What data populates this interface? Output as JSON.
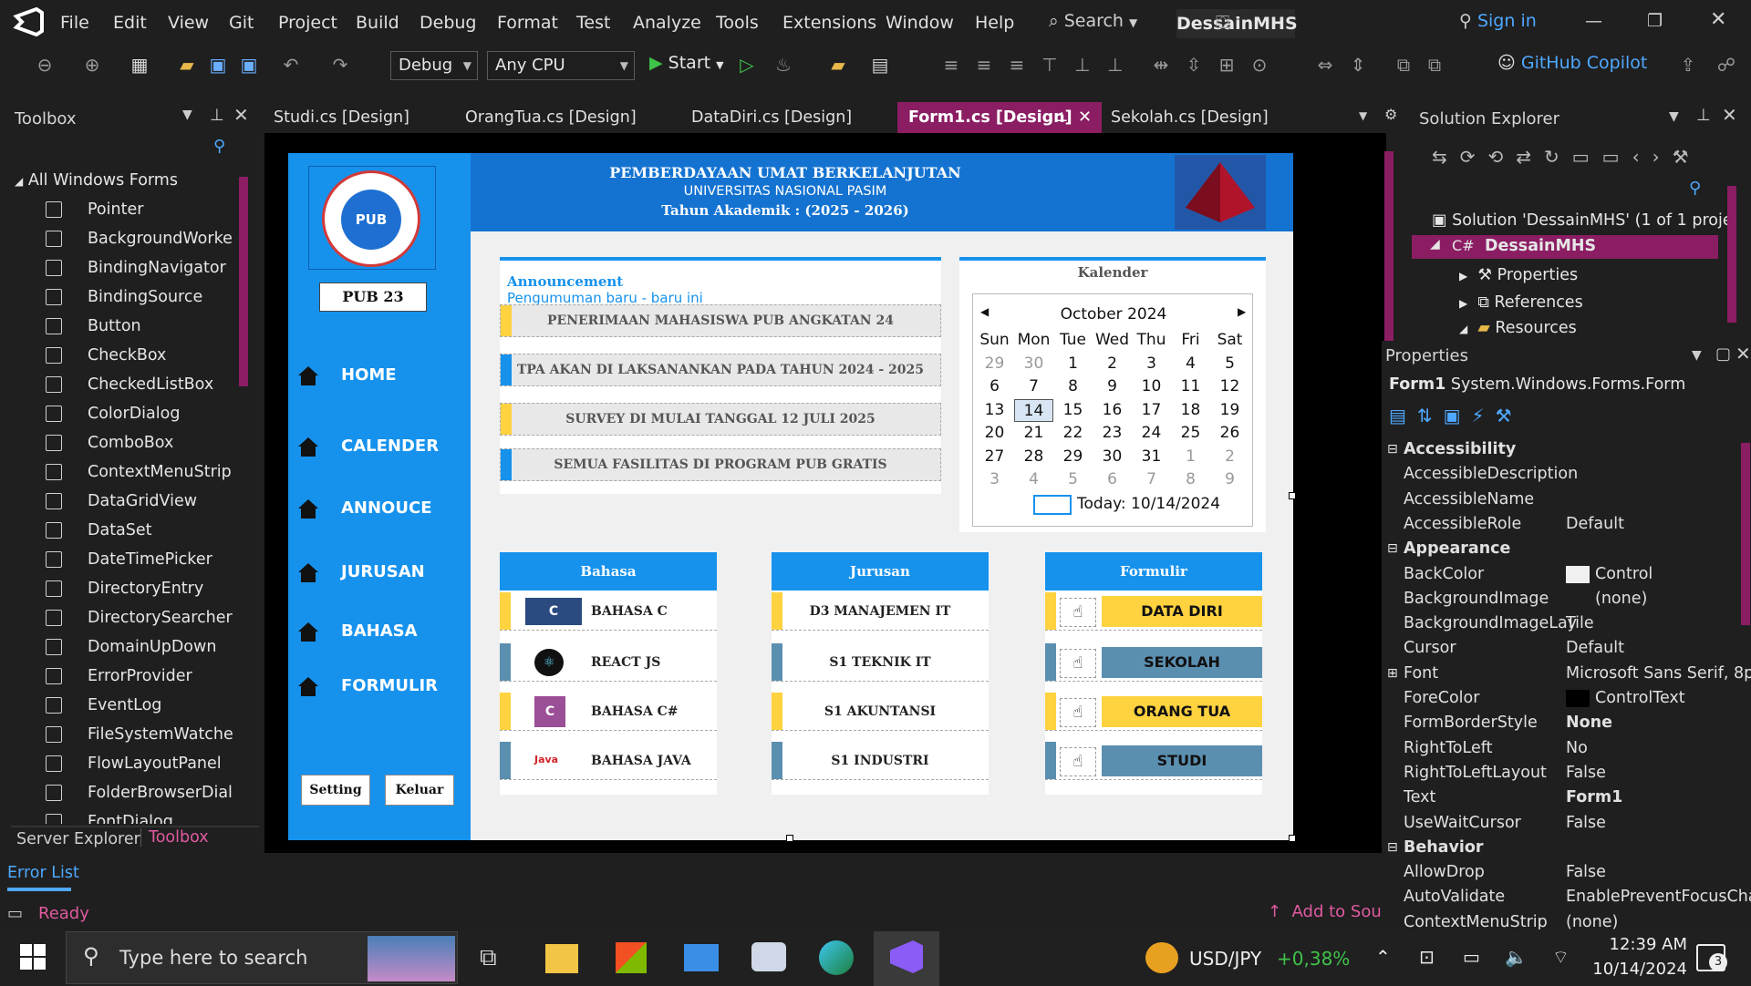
{
  "menu": {
    "items": [
      "File",
      "Edit",
      "View",
      "Git",
      "Project",
      "Build",
      "Debug",
      "Format",
      "Test",
      "Analyze",
      "Tools",
      "Extensions",
      "Window",
      "Help"
    ],
    "search": "Search",
    "solution_title": "DessainMHS",
    "signin": "Sign in"
  },
  "toolbar": {
    "config": "Debug",
    "platform": "Any CPU",
    "start": "Start",
    "copilot": "GitHub Copilot"
  },
  "toolbox": {
    "title": "Toolbox",
    "group": "All Windows Forms",
    "items": [
      "Pointer",
      "BackgroundWorker",
      "BindingNavigator",
      "BindingSource",
      "Button",
      "CheckBox",
      "CheckedListBox",
      "ColorDialog",
      "ComboBox",
      "ContextMenuStrip",
      "DataGridView",
      "DataSet",
      "DateTimePicker",
      "DirectoryEntry",
      "DirectorySearcher",
      "DomainUpDown",
      "ErrorProvider",
      "EventLog",
      "FileSystemWatcher",
      "FlowLayoutPanel",
      "FolderBrowserDial...",
      "FontDialog"
    ],
    "tab_server": "Server Explorer",
    "tab_toolbox": "Toolbox"
  },
  "tabs": [
    "Studi.cs [Design]",
    "OrangTua.cs [Design]",
    "DataDiri.cs [Design]",
    "Form1.cs [Design]",
    "Sekolah.cs [Design]"
  ],
  "form": {
    "logo_text": "PUB",
    "badge": "PUB 23",
    "nav": [
      "HOME",
      "CALENDER",
      "ANNOUCE",
      "JURUSAN",
      "BAHASA",
      "FORMULIR"
    ],
    "btn_setting": "Setting",
    "btn_keluar": "Keluar",
    "header": {
      "line1": "PEMBERDAYAAN UMAT BERKELANJUTAN",
      "line2": "UNIVERSITAS NASIONAL PASIM",
      "line3": "Tahun Akademik : (2025 - 2026)"
    },
    "announcement": {
      "title": "Announcement",
      "subtitle": "Pengumuman baru - baru ini",
      "rows": [
        "PENERIMAAN MAHASISWA PUB ANGKATAN 24",
        "TPA AKAN DI LAKSANANKAN PADA TAHUN 2024 - 2025",
        "SURVEY DI MULAI TANGGAL 12 JULI 2025",
        "SEMUA FASILITAS DI PROGRAM PUB GRATIS"
      ]
    },
    "calendar": {
      "title": "Kalender",
      "month": "October 2024",
      "days": [
        "Sun",
        "Mon",
        "Tue",
        "Wed",
        "Thu",
        "Fri",
        "Sat"
      ],
      "weeks": [
        [
          "29",
          "30",
          "1",
          "2",
          "3",
          "4",
          "5"
        ],
        [
          "6",
          "7",
          "8",
          "9",
          "10",
          "11",
          "12"
        ],
        [
          "13",
          "14",
          "15",
          "16",
          "17",
          "18",
          "19"
        ],
        [
          "20",
          "21",
          "22",
          "23",
          "24",
          "25",
          "26"
        ],
        [
          "27",
          "28",
          "29",
          "30",
          "31",
          "1",
          "2"
        ],
        [
          "3",
          "4",
          "5",
          "6",
          "7",
          "8",
          "9"
        ]
      ],
      "today": "Today: 10/14/2024"
    },
    "bahasa": {
      "title": "Bahasa",
      "rows": [
        "BAHASA C",
        "REACT JS",
        "BAHASA C#",
        "BAHASA JAVA"
      ],
      "java_logo": "Java"
    },
    "jurusan": {
      "title": "Jurusan",
      "rows": [
        "D3 MANAJEMEN IT",
        "S1 TEKNIK IT",
        "S1 AKUNTANSI",
        "S1 INDUSTRI"
      ]
    },
    "formulir": {
      "title": "Formulir",
      "rows": [
        "DATA DIRI",
        "SEKOLAH",
        "ORANG TUA",
        "STUDI"
      ]
    }
  },
  "solution": {
    "title": "Solution Explorer",
    "root": "Solution 'DessainMHS' (1 of 1 proje",
    "project": "DessainMHS",
    "items": [
      "Properties",
      "References",
      "Resources"
    ]
  },
  "properties": {
    "title": "Properties",
    "object": "Form1",
    "type": "System.Windows.Forms.Form",
    "rows": [
      {
        "cat": true,
        "name": "Accessibility"
      },
      {
        "name": "AccessibleDescription",
        "value": ""
      },
      {
        "name": "AccessibleName",
        "value": ""
      },
      {
        "name": "AccessibleRole",
        "value": "Default"
      },
      {
        "cat": true,
        "name": "Appearance"
      },
      {
        "name": "BackColor",
        "value": "Control"
      },
      {
        "name": "BackgroundImage",
        "value": "(none)"
      },
      {
        "name": "BackgroundImageLay",
        "value": "Tile"
      },
      {
        "name": "Cursor",
        "value": "Default"
      },
      {
        "name": "Font",
        "value": "Microsoft Sans Serif, 8p"
      },
      {
        "name": "ForeColor",
        "value": "ControlText"
      },
      {
        "name": "FormBorderStyle",
        "value": "None"
      },
      {
        "name": "RightToLeft",
        "value": "No"
      },
      {
        "name": "RightToLeftLayout",
        "value": "False"
      },
      {
        "name": "Text",
        "value": "Form1"
      },
      {
        "name": "UseWaitCursor",
        "value": "False"
      },
      {
        "cat": true,
        "name": "Behavior"
      },
      {
        "name": "AllowDrop",
        "value": "False"
      },
      {
        "name": "AutoValidate",
        "value": "EnablePreventFocusCha"
      },
      {
        "name": "ContextMenuStrip",
        "value": "(none)"
      }
    ]
  },
  "status": {
    "error_list": "Error List",
    "ready": "Ready",
    "add_source": "Add to Sou"
  },
  "taskbar": {
    "search": "Type here to search",
    "ticker": "USD/JPY",
    "change": "+0,38%",
    "time": "12:39 AM",
    "date": "10/14/2024",
    "notif": "3"
  },
  "colors": {
    "accent": "#8b1d63",
    "form_blue": "#1692ed",
    "yellow": "#ffd23f",
    "steel": "#5b8fb0"
  }
}
